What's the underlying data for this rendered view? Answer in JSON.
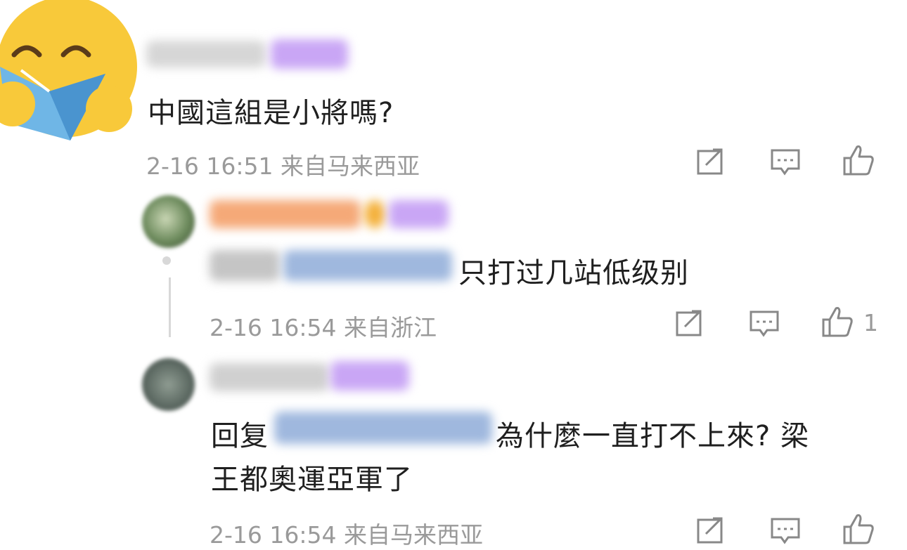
{
  "comments": [
    {
      "text": "中國這組是小將嗎?",
      "time": "2-16 16:51",
      "location": "来自马来西亚"
    }
  ],
  "replies": [
    {
      "text_suffix": "只打过几站低级别",
      "time": "2-16 16:54",
      "location": "来自浙江",
      "like_count": "1"
    },
    {
      "reply_prefix": "回复",
      "text_suffix": "為什麼一直打不上來? 梁",
      "text_line2": "王都奧運亞軍了",
      "time": "2-16 16:54",
      "location": "来自马来西亚"
    }
  ],
  "icons": {
    "share": "share-icon",
    "comment": "comment-icon",
    "like": "thumbs-up-icon"
  },
  "colors": {
    "meta_text": "#9a9a9a",
    "badge_purple": "#c9a6f5",
    "mention_blue": "#5a88c8",
    "orange_name": "#f5a978"
  }
}
